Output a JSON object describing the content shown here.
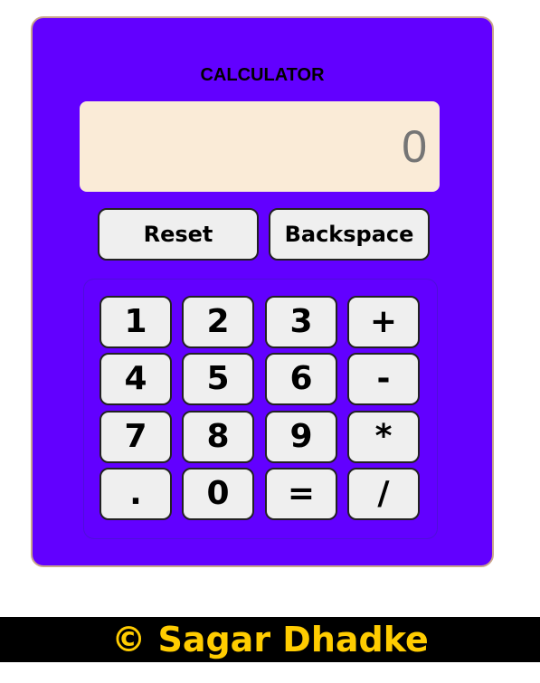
{
  "calculator": {
    "title": "CALCULATOR",
    "display_value": "0",
    "reset_label": "Reset",
    "backspace_label": "Backspace",
    "keys": [
      [
        "1",
        "2",
        "3",
        "+"
      ],
      [
        "4",
        "5",
        "6",
        "-"
      ],
      [
        "7",
        "8",
        "9",
        "*"
      ],
      [
        ".",
        "0",
        "=",
        "/"
      ]
    ]
  },
  "footer": {
    "text": "© Sagar Dhadke"
  },
  "colors": {
    "panel": "#6200ff",
    "display_background": "#faebd7",
    "button_background": "#efefef",
    "footer_background": "#000000",
    "footer_text": "#ffcc00"
  }
}
